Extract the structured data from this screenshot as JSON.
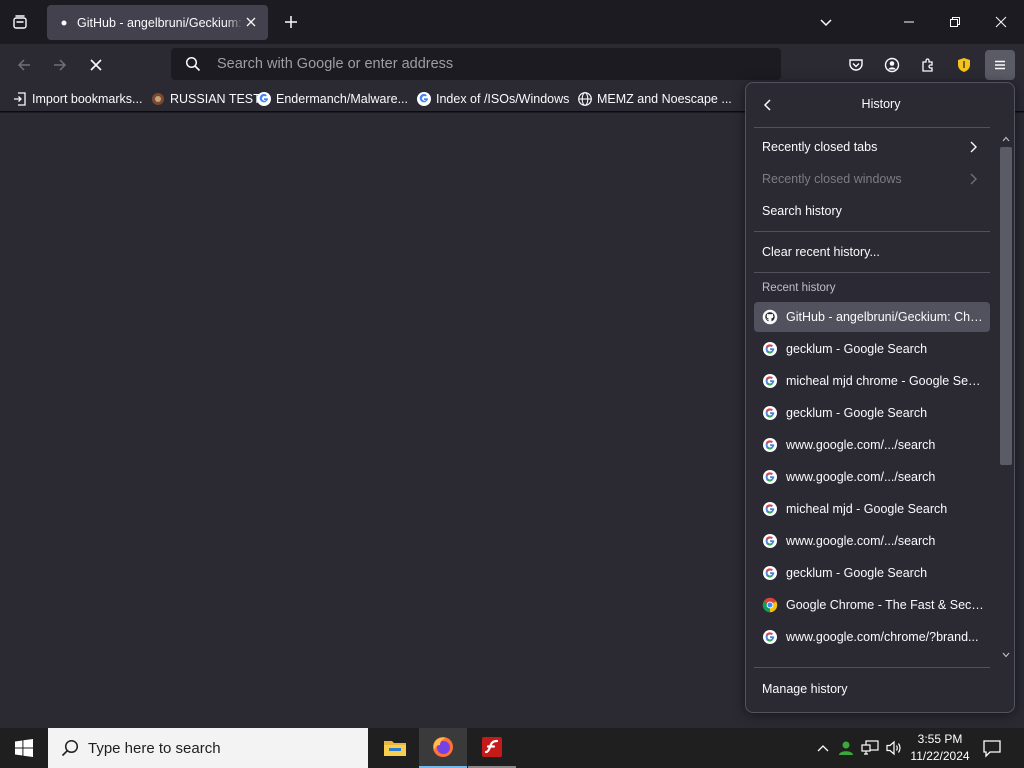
{
  "tab": {
    "title": "GitHub - angelbruni/Geckium: Chrome"
  },
  "urlbar": {
    "placeholder": "Search with Google or enter address",
    "value": ""
  },
  "bookmarks": [
    {
      "label": "Import bookmarks...",
      "icon": "import-icon"
    },
    {
      "label": "RUSSIAN TEST",
      "icon": "site-icon"
    },
    {
      "label": "Endermanch/Malware...",
      "icon": "google-icon"
    },
    {
      "label": "Index of /ISOs/Windows",
      "icon": "google-icon"
    },
    {
      "label": "MEMZ and Noescape ...",
      "icon": "globe-icon"
    }
  ],
  "panel": {
    "title": "History",
    "recently_closed_tabs": "Recently closed tabs",
    "recently_closed_windows": "Recently closed windows",
    "search_history": "Search history",
    "clear_recent_history": "Clear recent history...",
    "recent_history_label": "Recent history",
    "history_items": [
      {
        "label": "GitHub - angelbruni/Geckium: Chrome",
        "icon": "github-icon"
      },
      {
        "label": "gecklum - Google Search",
        "icon": "google-icon"
      },
      {
        "label": "micheal mjd chrome - Google Search",
        "icon": "google-icon"
      },
      {
        "label": "gecklum - Google Search",
        "icon": "google-icon"
      },
      {
        "label": "www.google.com/.../search",
        "icon": "google-icon"
      },
      {
        "label": "www.google.com/.../search",
        "icon": "google-icon"
      },
      {
        "label": "micheal mjd - Google Search",
        "icon": "google-icon"
      },
      {
        "label": "www.google.com/.../search",
        "icon": "google-icon"
      },
      {
        "label": "gecklum - Google Search",
        "icon": "google-icon"
      },
      {
        "label": "Google Chrome - The Fast & Secure Web Browser",
        "icon": "chrome-icon"
      },
      {
        "label": "www.google.com/chrome/?brand...",
        "icon": "google-icon"
      }
    ],
    "manage_history": "Manage history"
  },
  "taskbar": {
    "search_placeholder": "Type here to search",
    "time": "3:55 PM",
    "date": "11/22/2024"
  },
  "colors": {
    "accent": "#76b9ed",
    "panel_bg": "#2b2a33",
    "hover_bg": "#52525e"
  }
}
